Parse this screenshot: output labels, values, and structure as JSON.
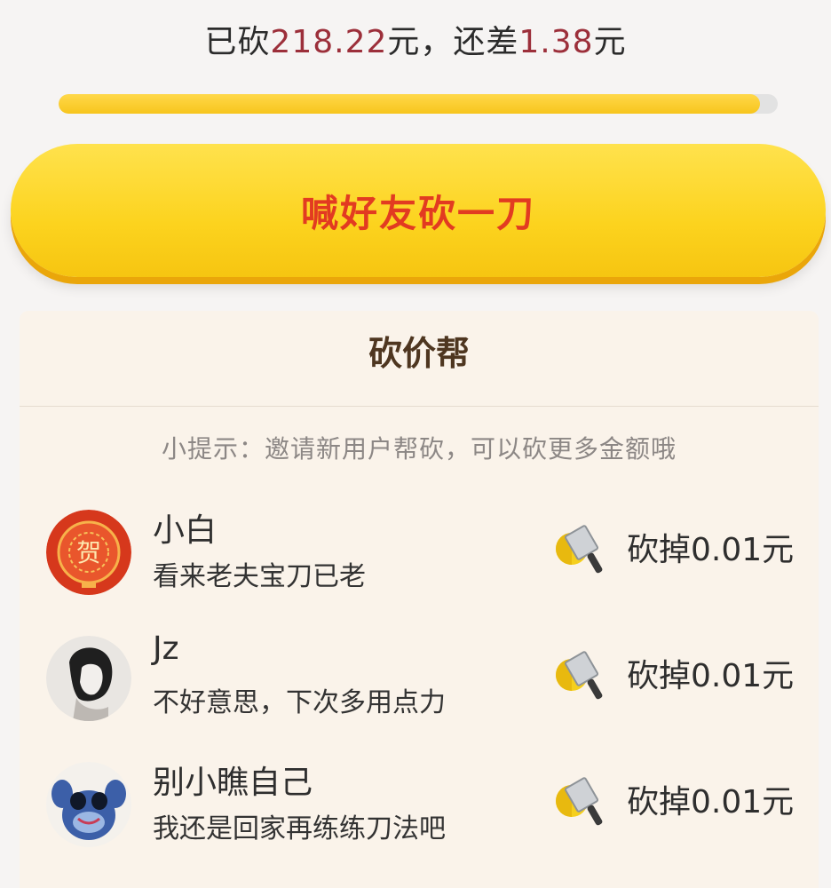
{
  "status": {
    "prefix": "已砍",
    "cut_amount": "218.22",
    "middle": "元，还差",
    "remaining": "1.38",
    "suffix": "元"
  },
  "progress": {
    "fraction": 0.975
  },
  "cta": {
    "label": "喊好友砍一刀"
  },
  "panel": {
    "title": "砍价帮",
    "tip": "小提示：邀请新用户帮砍，可以砍更多金额哦"
  },
  "helpers": [
    {
      "name": "小白",
      "message": "看来老夫宝刀已老",
      "cut": "砍掉0.01元",
      "avatar": "red-fortune-avatar"
    },
    {
      "name": "Jz",
      "message": "不好意思，下次多用点力",
      "cut": "砍掉0.01元",
      "avatar": "woman-portrait-avatar"
    },
    {
      "name": "别小瞧自己",
      "message": "我还是回家再练练刀法吧",
      "cut": "砍掉0.01元",
      "avatar": "blue-cartoon-avatar"
    }
  ],
  "icons": {
    "cut": "cleaver-coin-icon"
  },
  "colors": {
    "accent": "#fcd31e",
    "cta_text": "#e23b21",
    "amount": "#9c2f3a"
  }
}
